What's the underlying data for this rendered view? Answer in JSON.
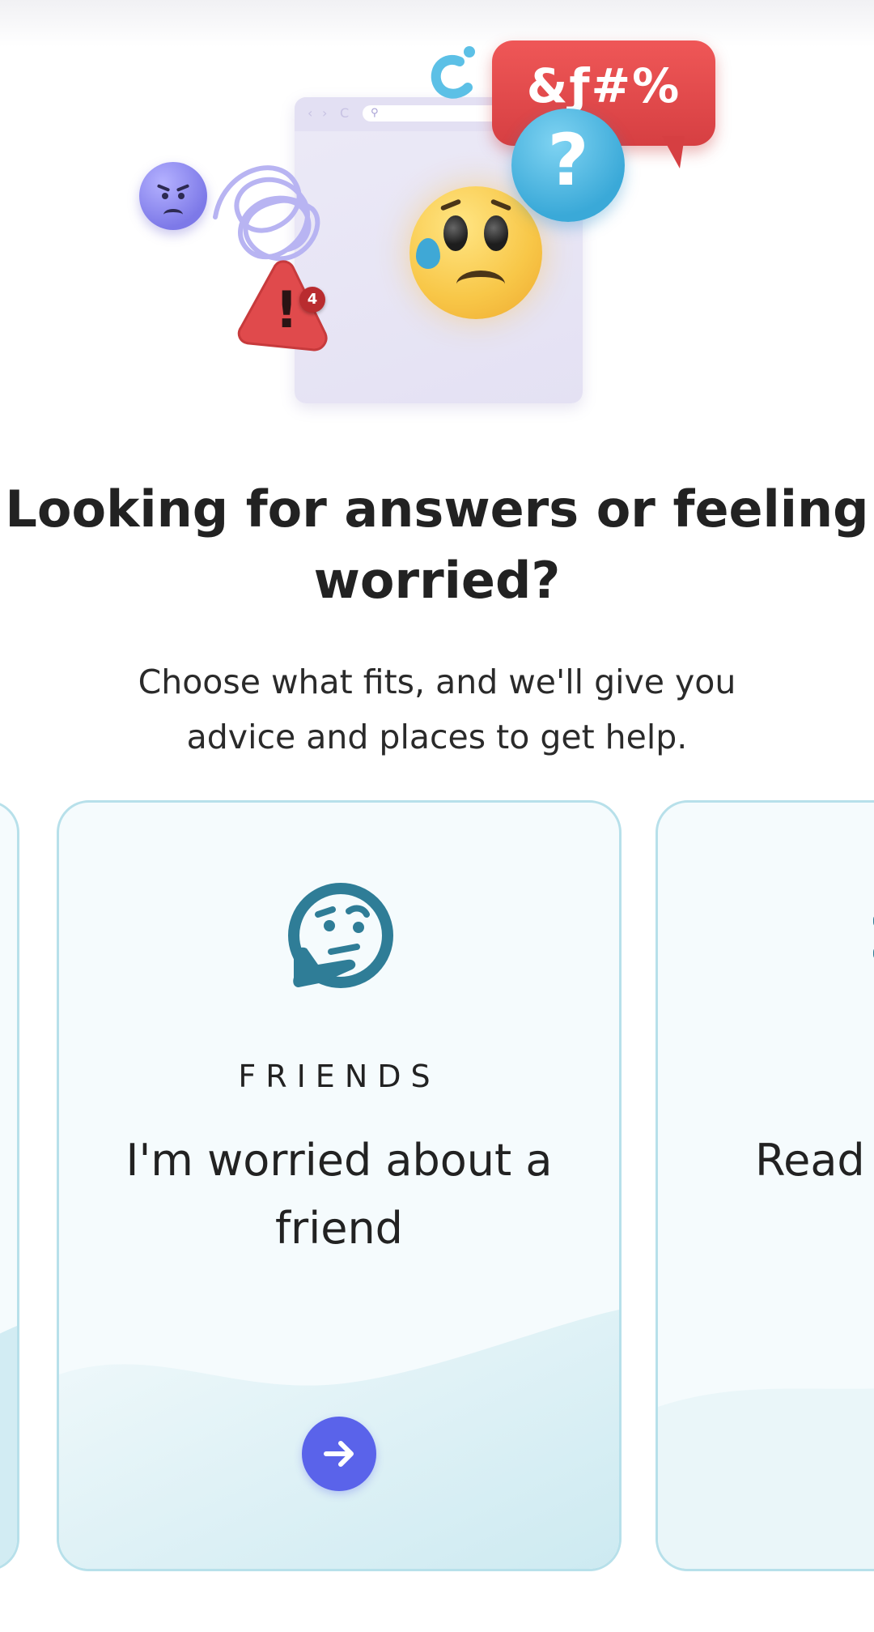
{
  "hero": {
    "curse_text": "&ƒ#%",
    "question_mark": "?",
    "warning_mark": "!",
    "warning_count": "4",
    "icons": [
      "angry-face-icon",
      "scribble-icon",
      "warning-icon",
      "sad-face-icon",
      "curse-bubble-icon",
      "question-bubble-icon",
      "browser-window-icon"
    ]
  },
  "headline": "Looking for answers or feeling worried?",
  "subtext": "Choose what fits, and we'll give you advice and places to get help.",
  "cards": {
    "main": {
      "category": "FRIENDS",
      "title": "I'm worried about a friend",
      "icon": "thinking-face-icon",
      "action_icon": "arrow-right-icon"
    },
    "right": {
      "title_partial": "Read"
    }
  },
  "colors": {
    "accent": "#5a63ea",
    "card_border": "#b7e0ea",
    "icon_teal": "#2f7d97",
    "curse_red": "#d63f42",
    "question_blue": "#3aa9d8"
  }
}
